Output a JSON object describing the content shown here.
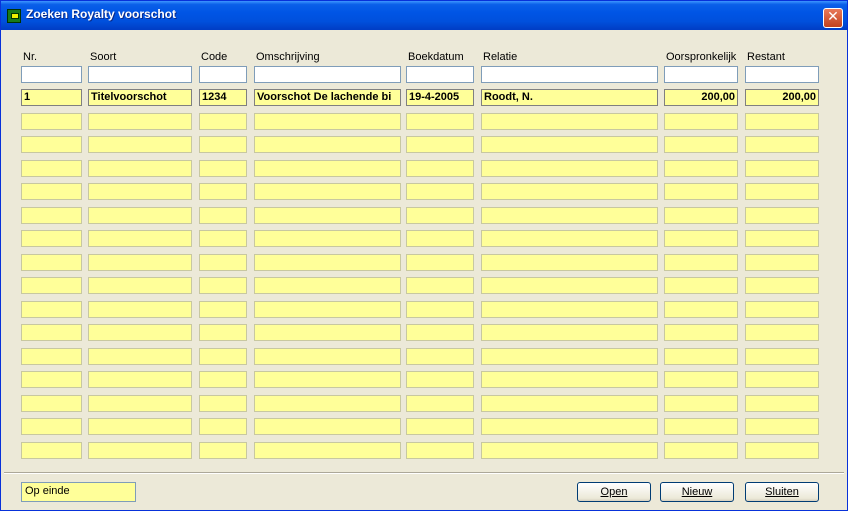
{
  "window": {
    "title": "Zoeken Royalty voorschot",
    "close_label": "✕"
  },
  "columns": [
    "Nr.",
    "Soort",
    "Code",
    "Omschrijving",
    "Boekdatum",
    "Relatie",
    "Oorspronkelijk",
    "Restant"
  ],
  "rows": [
    [
      "1",
      "Titelvoorschot",
      "1234",
      "Voorschot De lachende bi",
      "19-4-2005",
      "Roodt, N.",
      "200,00",
      "200,00"
    ]
  ],
  "empty_row_count": 15,
  "status_text": "Op einde",
  "buttons": {
    "open": "Open",
    "new": "Nieuw",
    "close": "Sluiten"
  },
  "colors": {
    "cell_bg": "#ffff99",
    "titlebar": "#0055e5",
    "window_bg": "#ece9d8"
  },
  "icons": {
    "title": "app-icon",
    "close": "close-icon"
  }
}
